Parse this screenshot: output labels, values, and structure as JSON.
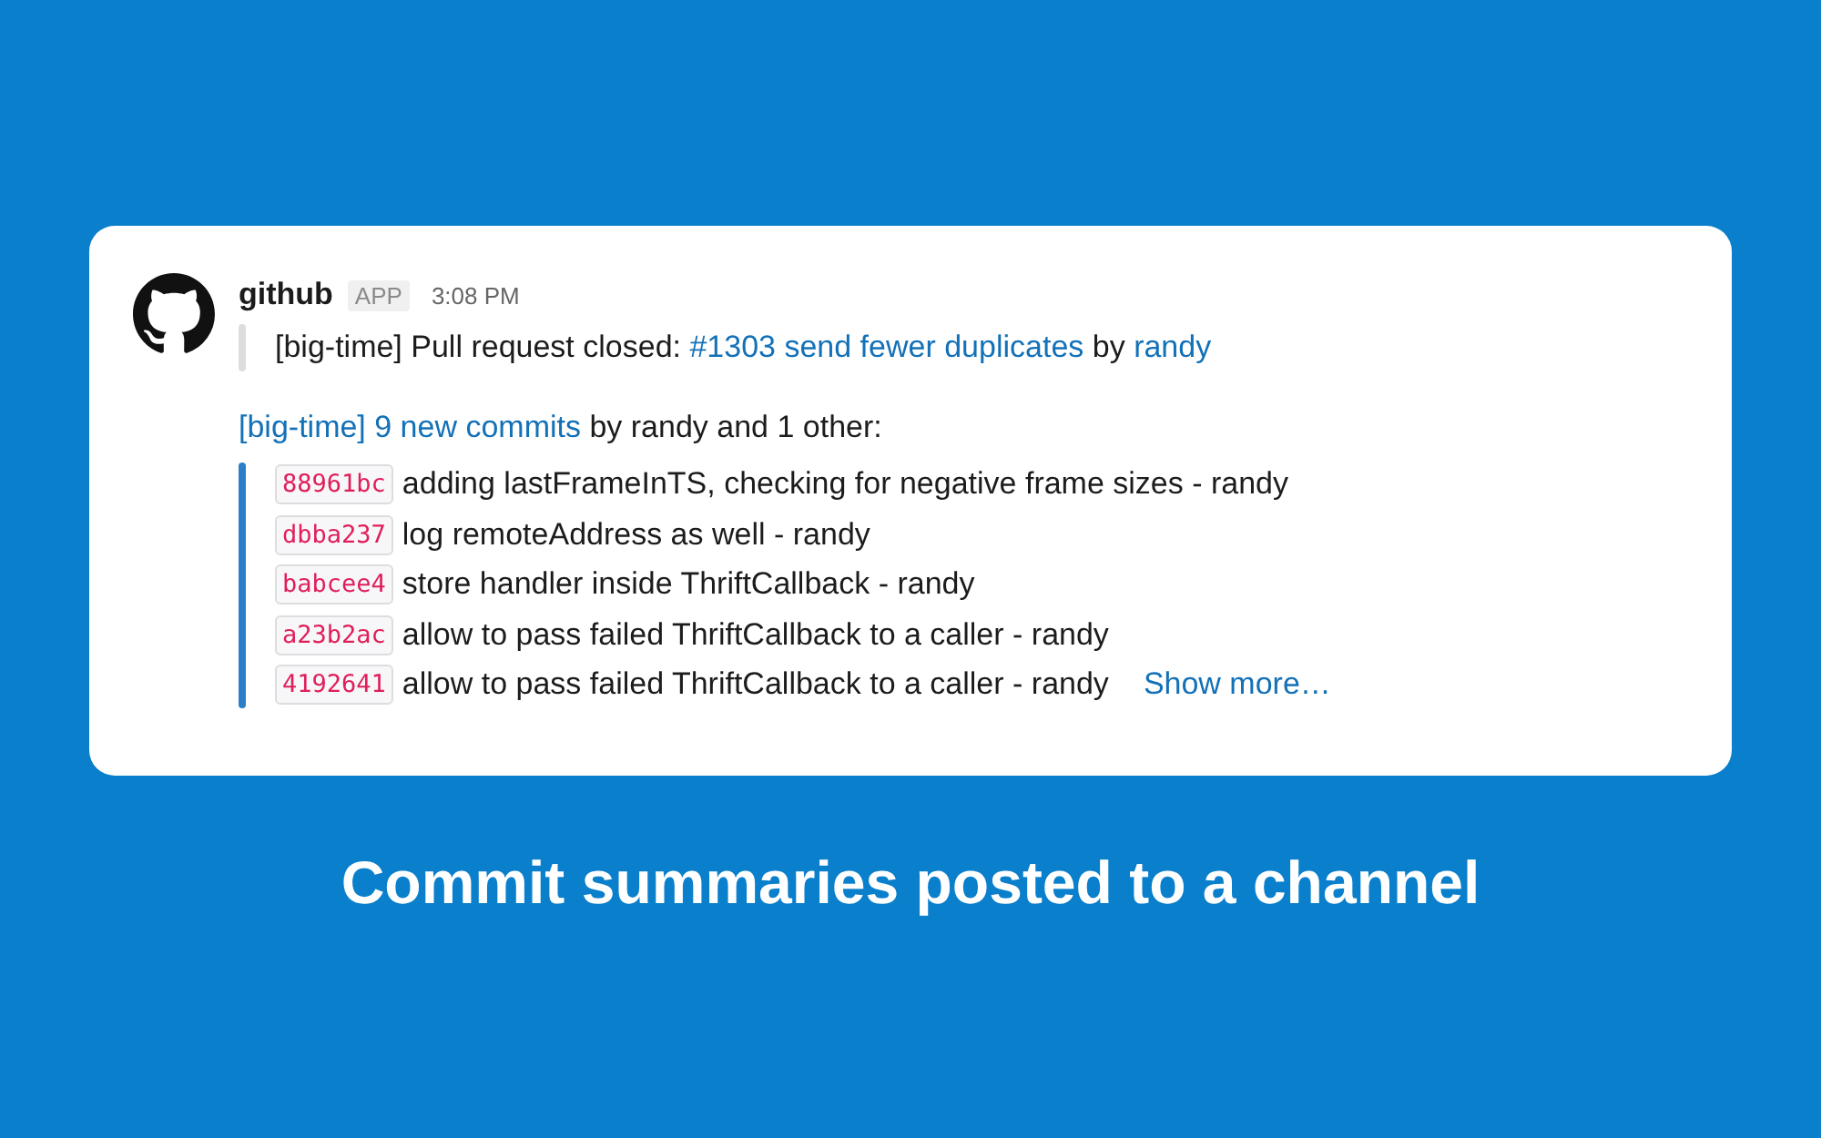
{
  "message": {
    "sender": "github",
    "badge": "APP",
    "time": "3:08 PM",
    "attachments": [
      {
        "color": "#dddddd",
        "segments": [
          {
            "kind": "plain",
            "text": "[big-time] Pull request closed: "
          },
          {
            "kind": "link",
            "text": "#1303 send fewer duplicates"
          },
          {
            "kind": "plain",
            "text": " by "
          },
          {
            "kind": "link",
            "text": "randy"
          }
        ]
      }
    ],
    "summary": [
      {
        "kind": "link",
        "text": "[big-time] 9 new commits"
      },
      {
        "kind": "plain",
        "text": " by randy and 1 other:"
      }
    ],
    "commits_bar": {
      "color": "#2a80c8"
    },
    "commits": [
      {
        "hash": "88961bc",
        "message": "adding lastFrameInTS, checking for negative frame sizes - randy"
      },
      {
        "hash": "dbba237",
        "message": "log remoteAddress as well - randy"
      },
      {
        "hash": "babcee4",
        "message": "store handler inside ThriftCallback - randy"
      },
      {
        "hash": "a23b2ac",
        "message": "allow to pass failed ThriftCallback to a caller - randy"
      },
      {
        "hash": "4192641",
        "message": "allow to pass failed ThriftCallback to a caller - randy"
      }
    ],
    "show_more": "Show more…"
  },
  "caption": "Commit summaries posted to a channel"
}
